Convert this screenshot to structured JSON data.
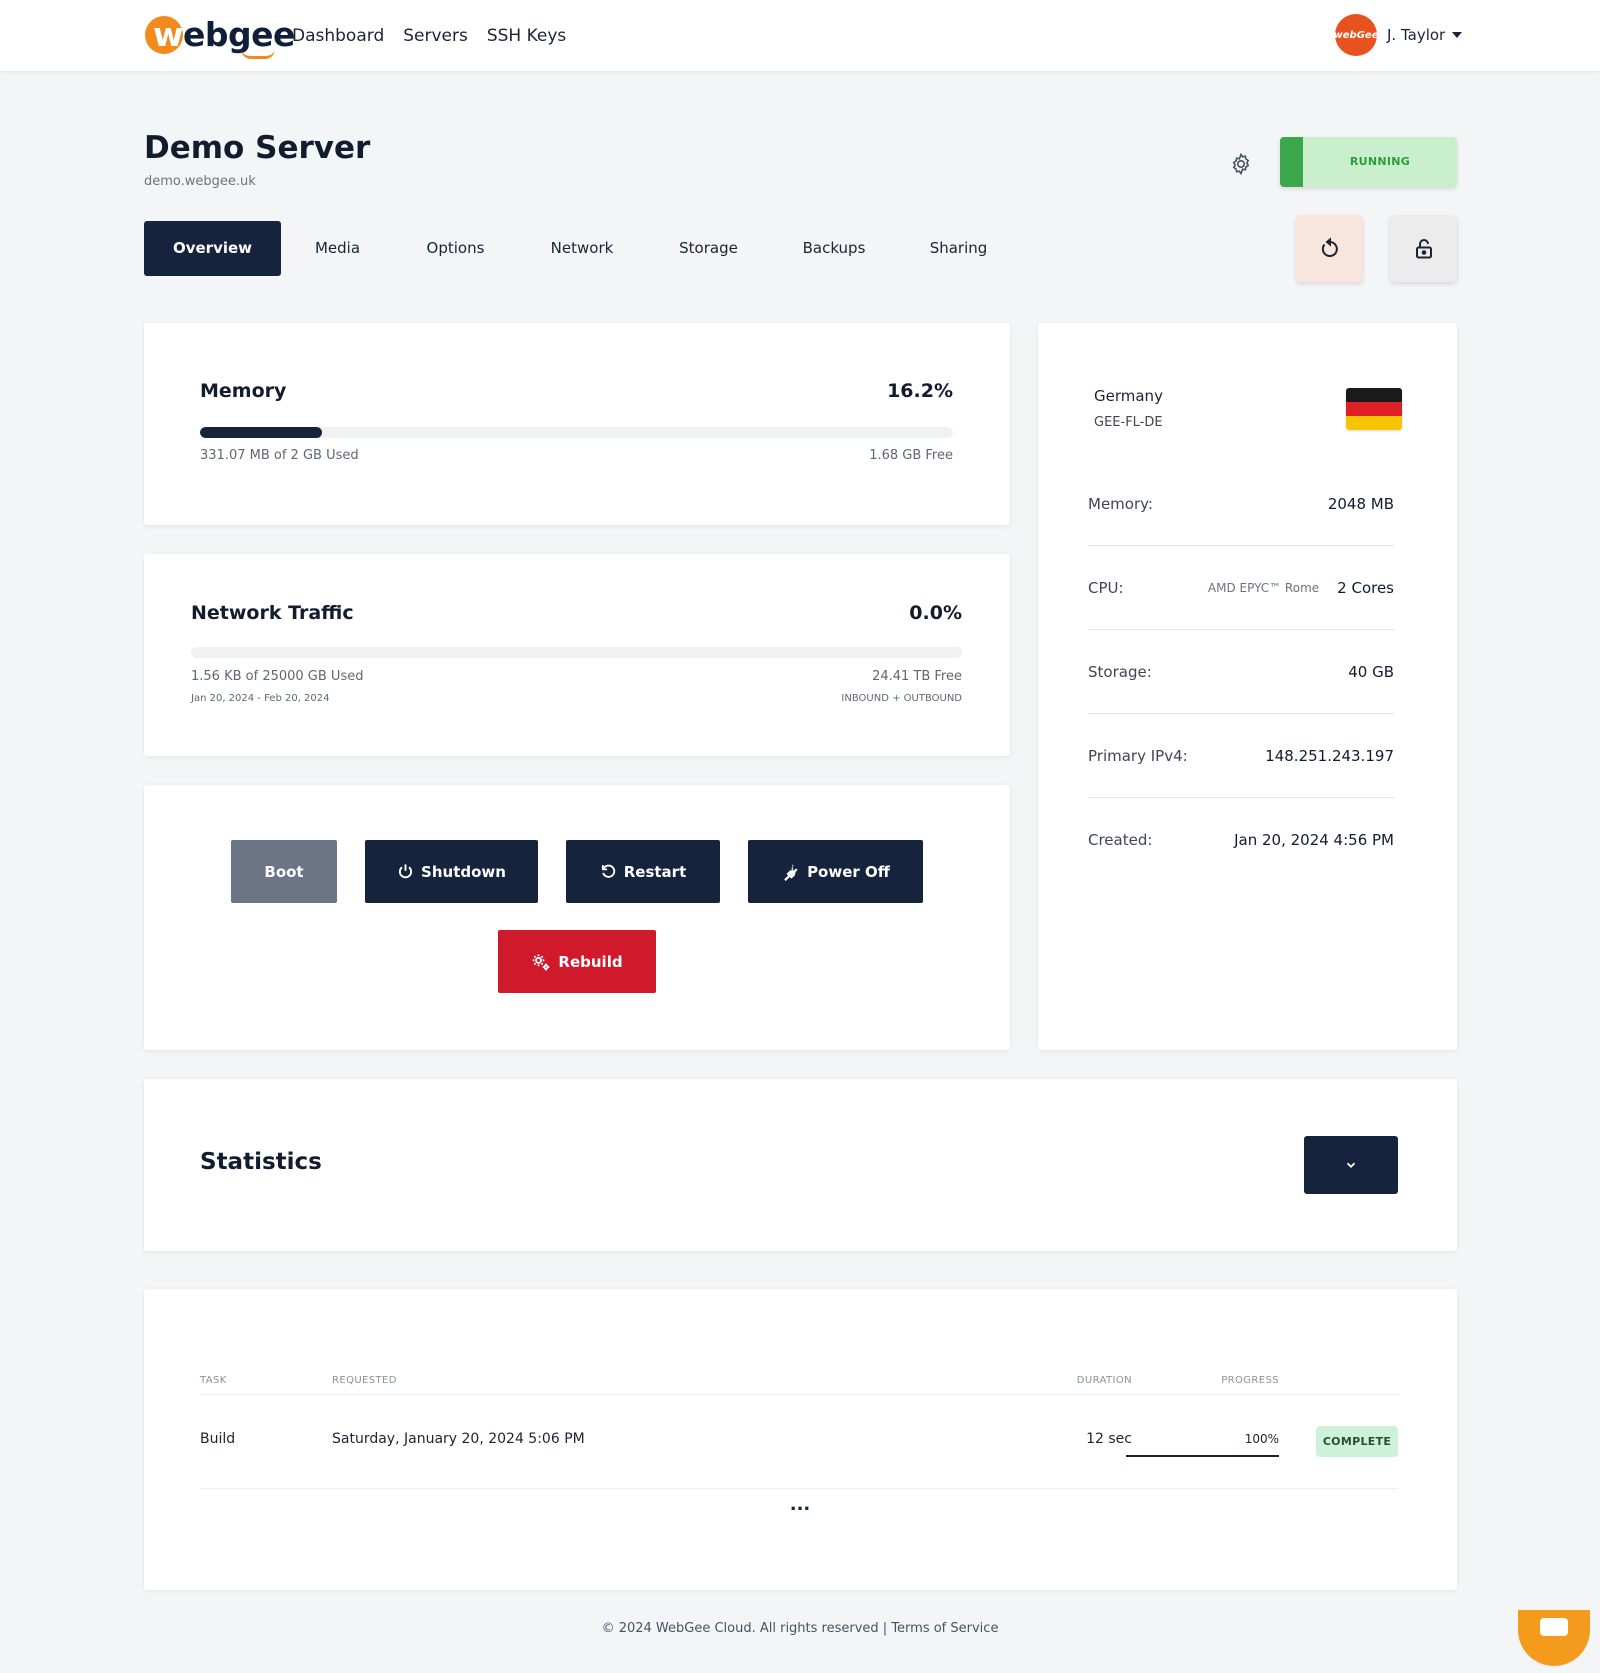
{
  "brand": {
    "name": "webgee",
    "first_letter": "w",
    "rest": "ebgee"
  },
  "nav": {
    "links": [
      "Dashboard",
      "Servers",
      "SSH Keys"
    ]
  },
  "user": {
    "name": "J. Taylor",
    "avatar_text": "webGee"
  },
  "server": {
    "title": "Demo Server",
    "hostname": "demo.webgee.uk",
    "status": "RUNNING"
  },
  "tabs": [
    "Overview",
    "Media",
    "Options",
    "Network",
    "Storage",
    "Backups",
    "Sharing"
  ],
  "memory": {
    "title": "Memory",
    "percent_label": "16.2%",
    "percent": 16.2,
    "used_label": "331.07 MB of 2 GB Used",
    "free_label": "1.68 GB Free"
  },
  "network": {
    "title": "Network Traffic",
    "percent_label": "0.0%",
    "percent": 0.0,
    "used_label": "1.56 KB of 25000 GB Used",
    "free_label": "24.41 TB Free",
    "period": "Jan 20, 2024 - Feb 20, 2024",
    "direction": "INBOUND + OUTBOUND"
  },
  "actions": {
    "boot": "Boot",
    "shutdown": "Shutdown",
    "restart": "Restart",
    "power_off": "Power Off",
    "rebuild": "Rebuild"
  },
  "info": {
    "location": "Germany",
    "location_code": "GEE-FL-DE",
    "rows": [
      {
        "label": "Memory:",
        "extra": "",
        "value": "2048 MB"
      },
      {
        "label": "CPU:",
        "extra": "AMD EPYC™ Rome",
        "value": "2 Cores"
      },
      {
        "label": "Storage:",
        "extra": "",
        "value": "40 GB"
      },
      {
        "label": "Primary IPv4:",
        "extra": "",
        "value": "148.251.243.197"
      },
      {
        "label": "Created:",
        "extra": "",
        "value": "Jan 20, 2024 4:56 PM"
      }
    ]
  },
  "statistics": {
    "title": "Statistics"
  },
  "tasks": {
    "headers": {
      "task": "TASK",
      "requested": "REQUESTED",
      "duration": "DURATION",
      "progress": "PROGRESS"
    },
    "rows": [
      {
        "task": "Build",
        "requested": "Saturday, January 20, 2024 5:06 PM",
        "duration": "12 sec",
        "progress_label": "100%",
        "progress": 100,
        "status": "COMPLETE"
      }
    ],
    "more": "..."
  },
  "footer": {
    "text": "© 2024 WebGee Cloud. All rights reserved | Terms of Service"
  },
  "colors": {
    "navy": "#15233d",
    "accent_orange": "#f28a1c",
    "running_green": "#3aa84a",
    "danger_red": "#d01a2c"
  },
  "icons": [
    "gear-icon",
    "refresh-icon",
    "lock-icon",
    "power-icon",
    "restart-icon",
    "plug-icon",
    "cogs-icon",
    "chevron-down-icon",
    "germany-flag-icon",
    "chat-icon"
  ]
}
